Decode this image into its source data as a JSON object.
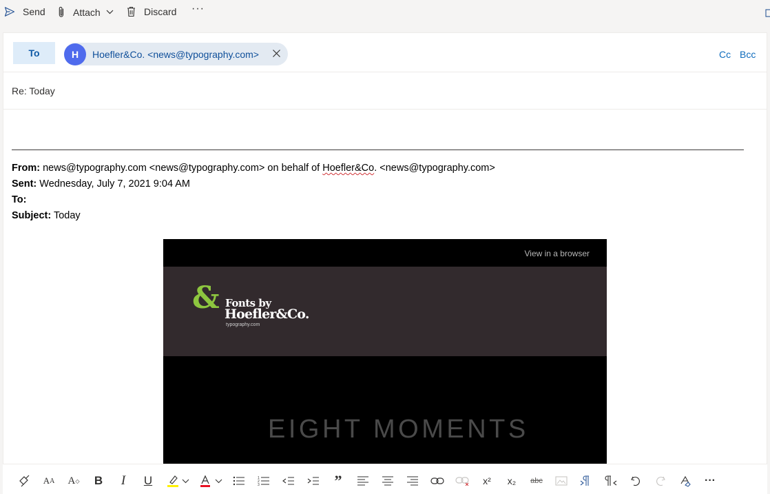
{
  "commandbar": {
    "send_label": "Send",
    "attach_label": "Attach",
    "discard_label": "Discard",
    "more_label": "···"
  },
  "recipients": {
    "to_label": "To",
    "chips": [
      {
        "initial": "H",
        "display": "Hoefler&Co. <news@typography.com>"
      }
    ],
    "cc_label": "Cc",
    "bcc_label": "Bcc"
  },
  "subject": {
    "value": "Re: Today"
  },
  "quoted_header": {
    "from_label": "From:",
    "from_value_pre": " news@typography.com <news@typography.com> on behalf of ",
    "from_value_sq": "Hoefler&Co",
    "from_value_post": ". <news@typography.com>",
    "sent_label": "Sent:",
    "sent_value": " Wednesday, July 7, 2021 9:04 AM",
    "to_label": "To:",
    "subject_label": "Subject:",
    "subject_value": " Today"
  },
  "newsletter": {
    "view_in_browser": "View in a browser",
    "brand_ampersand": "&",
    "brand_line1": "Fonts by",
    "brand_line2": "Hoefler&Co.",
    "brand_line3": "typography.com",
    "headline": "EIGHT MOMENTS"
  },
  "colors": {
    "accent": "#0f6cbd",
    "avatar": "#4f6bed",
    "chip_bg": "#e3eaf2",
    "brand_green": "#8dc63f",
    "brand_band": "#322a2d"
  },
  "format_toolbar": {
    "bold_label": "B",
    "italic_label": "I",
    "underline_label": "U",
    "quote_label": "”",
    "superscript_label": "x²",
    "subscript_label": "x₂",
    "strike_label": "abc",
    "more_label": "···"
  }
}
